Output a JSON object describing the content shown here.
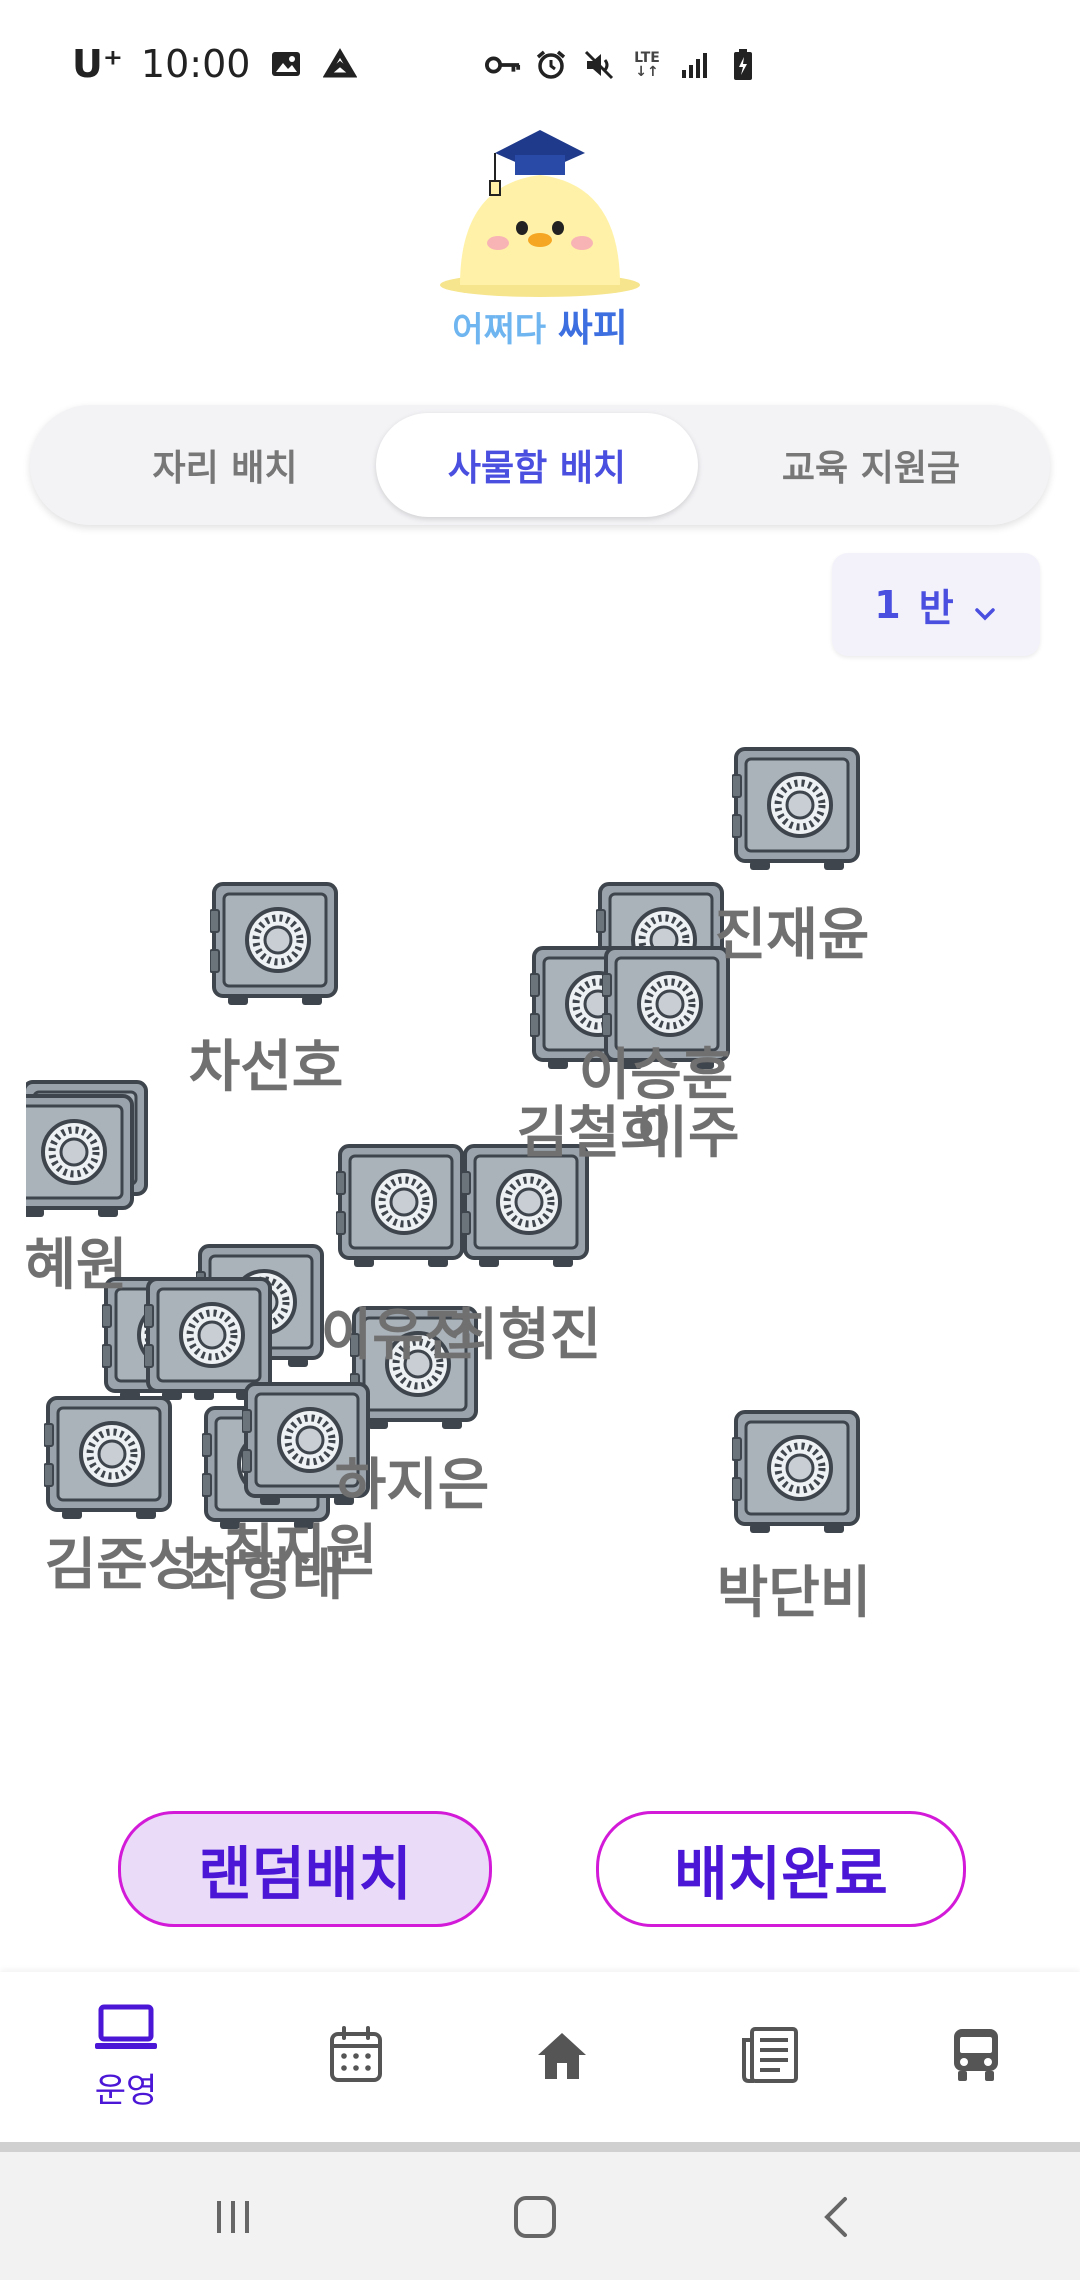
{
  "status_bar": {
    "carrier": "U⁺",
    "time": "10:00",
    "network": "LTE",
    "icons": [
      "image-icon",
      "sync-icon",
      "vpn-key-icon",
      "alarm-icon",
      "mute-icon",
      "lte-icon",
      "signal-icon",
      "battery-icon"
    ]
  },
  "logo": {
    "text_part1": "어쩌다",
    "text_part2": "싸피"
  },
  "tabs": [
    {
      "label": "자리 배치",
      "active": false
    },
    {
      "label": "사물함 배치",
      "active": true
    },
    {
      "label": "교육 지원금",
      "active": false
    }
  ],
  "class_select": {
    "number": "1",
    "unit": "반"
  },
  "lockers": {
    "labels": [
      "진재윤",
      "차선호",
      "이승훈",
      "김철희",
      "이주",
      "혜원",
      "이유진",
      "최형진",
      "하지은",
      "김준성",
      "최지원",
      "최형태",
      "박단비"
    ]
  },
  "actions": {
    "random_label": "랜덤배치",
    "done_label": "배치완료"
  },
  "bottom_nav": {
    "active_label": "운영",
    "items": [
      "laptop-icon",
      "calendar-icon",
      "home-icon",
      "newspaper-icon",
      "bus-icon"
    ]
  },
  "colors": {
    "accent": "#4a4fe0",
    "button_text": "#4b16d6",
    "button_border": "#d21ad8",
    "button_fill": "#eadcf8",
    "locker_body": "#9aa3ab",
    "label_gray": "#707070"
  }
}
